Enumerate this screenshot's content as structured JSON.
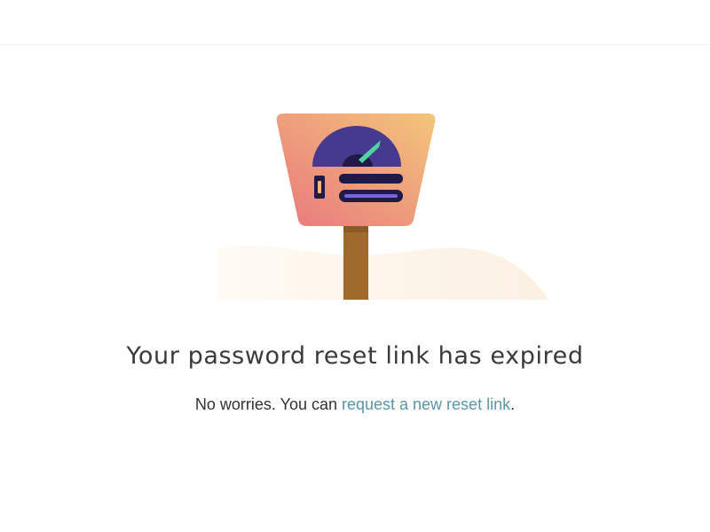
{
  "headline": "Your password reset link has expired",
  "message": {
    "prefix": "No worries. You can ",
    "link_text": "request a new reset link",
    "suffix": "."
  },
  "colors": {
    "link": "#5b94a8",
    "headline": "#3a3a3a",
    "sign_gradient_start": "#e97a7a",
    "sign_gradient_end": "#f2c078",
    "gauge": "#463a8f",
    "gauge_needle": "#4ed3a1",
    "post": "#a06a2c",
    "ground": "#fdf4ea"
  },
  "icons": {
    "illustration": "signpost-gauge-illustration"
  }
}
